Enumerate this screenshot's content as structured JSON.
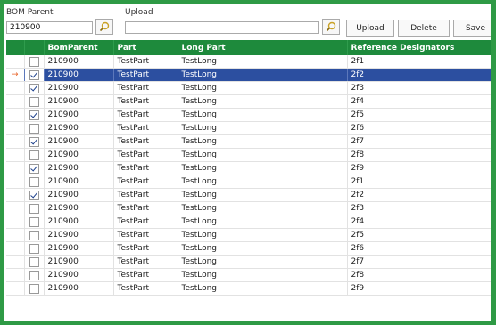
{
  "filters": {
    "bom_parent_label": "BOM Parent",
    "bom_parent_value": "210900",
    "upload_label": "Upload",
    "upload_value": ""
  },
  "toolbar": {
    "upload_label": "Upload",
    "delete_label": "Delete",
    "save_label": "Save"
  },
  "grid": {
    "columns": [
      "BomParent",
      "Part",
      "Long Part",
      "Reference Designators"
    ],
    "current_row_indicator": "→",
    "rows": [
      {
        "checked": false,
        "selected": false,
        "bom_parent": "210900",
        "part": "TestPart",
        "long_part": "TestLong",
        "ref": "2f1"
      },
      {
        "checked": true,
        "selected": true,
        "bom_parent": "210900",
        "part": "TestPart",
        "long_part": "TestLong",
        "ref": "2f2"
      },
      {
        "checked": true,
        "selected": false,
        "bom_parent": "210900",
        "part": "TestPart",
        "long_part": "TestLong",
        "ref": "2f3"
      },
      {
        "checked": false,
        "selected": false,
        "bom_parent": "210900",
        "part": "TestPart",
        "long_part": "TestLong",
        "ref": "2f4"
      },
      {
        "checked": true,
        "selected": false,
        "bom_parent": "210900",
        "part": "TestPart",
        "long_part": "TestLong",
        "ref": "2f5"
      },
      {
        "checked": false,
        "selected": false,
        "bom_parent": "210900",
        "part": "TestPart",
        "long_part": "TestLong",
        "ref": "2f6"
      },
      {
        "checked": true,
        "selected": false,
        "bom_parent": "210900",
        "part": "TestPart",
        "long_part": "TestLong",
        "ref": "2f7"
      },
      {
        "checked": false,
        "selected": false,
        "bom_parent": "210900",
        "part": "TestPart",
        "long_part": "TestLong",
        "ref": "2f8"
      },
      {
        "checked": true,
        "selected": false,
        "bom_parent": "210900",
        "part": "TestPart",
        "long_part": "TestLong",
        "ref": "2f9"
      },
      {
        "checked": false,
        "selected": false,
        "bom_parent": "210900",
        "part": "TestPart",
        "long_part": "TestLong",
        "ref": "2f1"
      },
      {
        "checked": true,
        "selected": false,
        "bom_parent": "210900",
        "part": "TestPart",
        "long_part": "TestLong",
        "ref": "2f2"
      },
      {
        "checked": false,
        "selected": false,
        "bom_parent": "210900",
        "part": "TestPart",
        "long_part": "TestLong",
        "ref": "2f3"
      },
      {
        "checked": false,
        "selected": false,
        "bom_parent": "210900",
        "part": "TestPart",
        "long_part": "TestLong",
        "ref": "2f4"
      },
      {
        "checked": false,
        "selected": false,
        "bom_parent": "210900",
        "part": "TestPart",
        "long_part": "TestLong",
        "ref": "2f5"
      },
      {
        "checked": false,
        "selected": false,
        "bom_parent": "210900",
        "part": "TestPart",
        "long_part": "TestLong",
        "ref": "2f6"
      },
      {
        "checked": false,
        "selected": false,
        "bom_parent": "210900",
        "part": "TestPart",
        "long_part": "TestLong",
        "ref": "2f7"
      },
      {
        "checked": false,
        "selected": false,
        "bom_parent": "210900",
        "part": "TestPart",
        "long_part": "TestLong",
        "ref": "2f8"
      },
      {
        "checked": false,
        "selected": false,
        "bom_parent": "210900",
        "part": "TestPart",
        "long_part": "TestLong",
        "ref": "2f9"
      }
    ]
  },
  "colors": {
    "frame_border": "#2e9a45",
    "header_bg": "#1e8a3c",
    "selected_row_bg": "#2c4fa0",
    "row_indicator": "#e8642a"
  },
  "icons": {
    "search": "magnifier-icon"
  }
}
